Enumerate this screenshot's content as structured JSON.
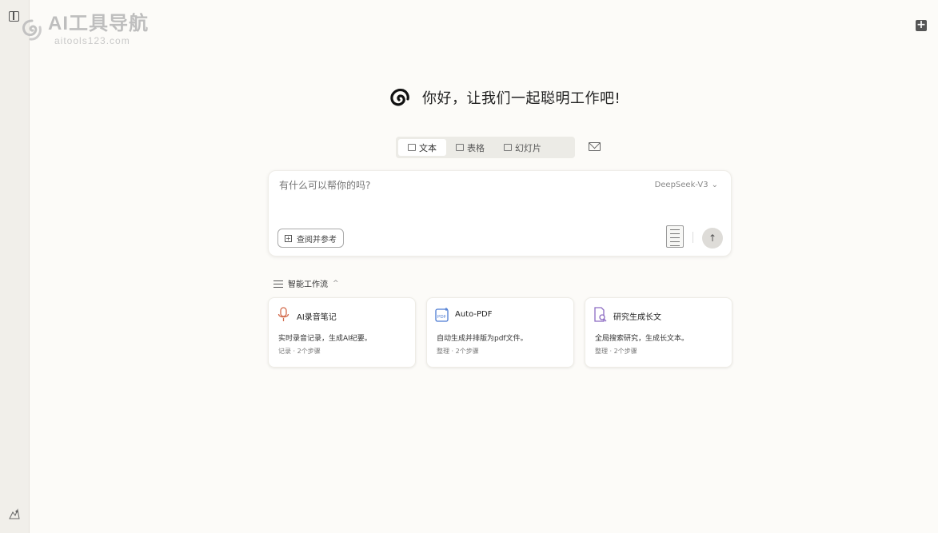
{
  "watermark": {
    "title": "AI工具导航",
    "subtitle": "aitools123.com"
  },
  "greeting": "你好，让我们一起聪明工作吧!",
  "tabs": [
    {
      "label": "文本",
      "active": true
    },
    {
      "label": "表格",
      "active": false
    },
    {
      "label": "幻灯片",
      "active": false
    }
  ],
  "input": {
    "placeholder": "有什么可以帮你的吗?",
    "model": "DeepSeek-V3",
    "reference_label": "查阅并参考"
  },
  "workflows": {
    "title": "智能工作流",
    "cards": [
      {
        "title": "AI录音笔记",
        "desc": "实时录音记录，生成AI纪要。",
        "meta": "记录 · 2个步骤",
        "icon": "microphone-icon",
        "color": "#d36b4c"
      },
      {
        "title": "Auto-PDF",
        "desc": "自动生成并排版为pdf文件。",
        "meta": "整理 · 2个步骤",
        "icon": "pdf-icon",
        "color": "#4c7bd3"
      },
      {
        "title": "研究生成长文",
        "desc": "全局搜索研究，生成长文本。",
        "meta": "整理 · 2个步骤",
        "icon": "research-doc-icon",
        "color": "#8c6bc2"
      }
    ]
  }
}
